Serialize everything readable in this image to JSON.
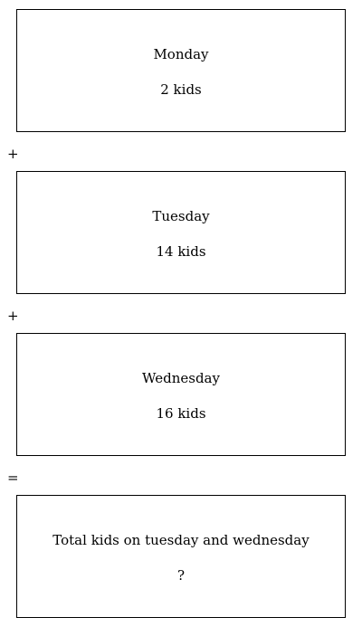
{
  "boxes": [
    {
      "title": "Monday",
      "value": "2 kids"
    },
    {
      "title": "Tuesday",
      "value": "14 kids"
    },
    {
      "title": "Wednesday",
      "value": "16 kids"
    },
    {
      "title": "Total kids on tuesday and wednesday",
      "value": "?"
    }
  ],
  "operators": [
    "+",
    "+",
    "="
  ]
}
